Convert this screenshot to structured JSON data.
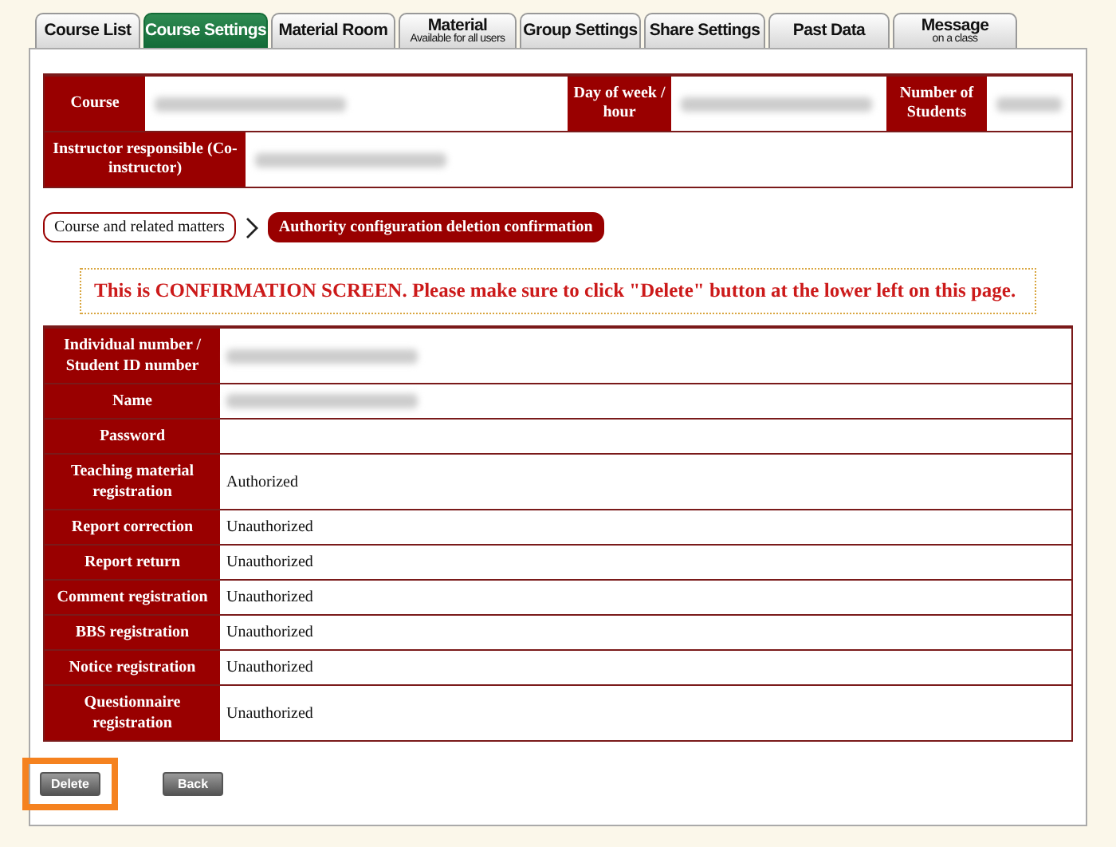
{
  "tabs": [
    {
      "label": "Course List",
      "selected": false
    },
    {
      "label": "Course Settings",
      "selected": true
    },
    {
      "label": "Material Room",
      "selected": false
    },
    {
      "label": "Material",
      "sublabel": "Available for all users",
      "selected": false
    },
    {
      "label": "Group Settings",
      "selected": false
    },
    {
      "label": "Share Settings",
      "selected": false
    },
    {
      "label": "Past Data",
      "selected": false
    },
    {
      "label": "Message",
      "sublabel": "on a class",
      "selected": false
    }
  ],
  "course_info": {
    "course": {
      "label": "Course",
      "redacted": true
    },
    "day": {
      "label": "Day of week / hour",
      "redacted": true
    },
    "students": {
      "label": "Number of Students",
      "redacted": true
    },
    "instructor": {
      "label": "Instructor responsible (Co-instructor)",
      "redacted": true
    }
  },
  "breadcrumb": [
    {
      "label": "Course and related matters",
      "selected": false
    },
    {
      "label": "Authority configuration deletion confirmation",
      "selected": true
    }
  ],
  "notice": "This is CONFIRMATION SCREEN. Please make sure to click \"Delete\" button at the lower left on this page.",
  "details": [
    {
      "label": "Individual number / Student ID number",
      "redacted": true
    },
    {
      "label": "Name",
      "redacted": true
    },
    {
      "label": "Password"
    },
    {
      "label": "Teaching material registration",
      "value": "Authorized"
    },
    {
      "label": "Report correction",
      "value": "Unauthorized"
    },
    {
      "label": "Report return",
      "value": "Unauthorized"
    },
    {
      "label": "Comment registration",
      "value": "Unauthorized"
    },
    {
      "label": "BBS registration",
      "value": "Unauthorized"
    },
    {
      "label": "Notice registration",
      "value": "Unauthorized"
    },
    {
      "label": "Questionnaire registration",
      "value": "Unauthorized"
    }
  ],
  "buttons": [
    {
      "label": "Delete",
      "highlighted": true
    },
    {
      "label": "Back",
      "highlighted": false
    }
  ]
}
